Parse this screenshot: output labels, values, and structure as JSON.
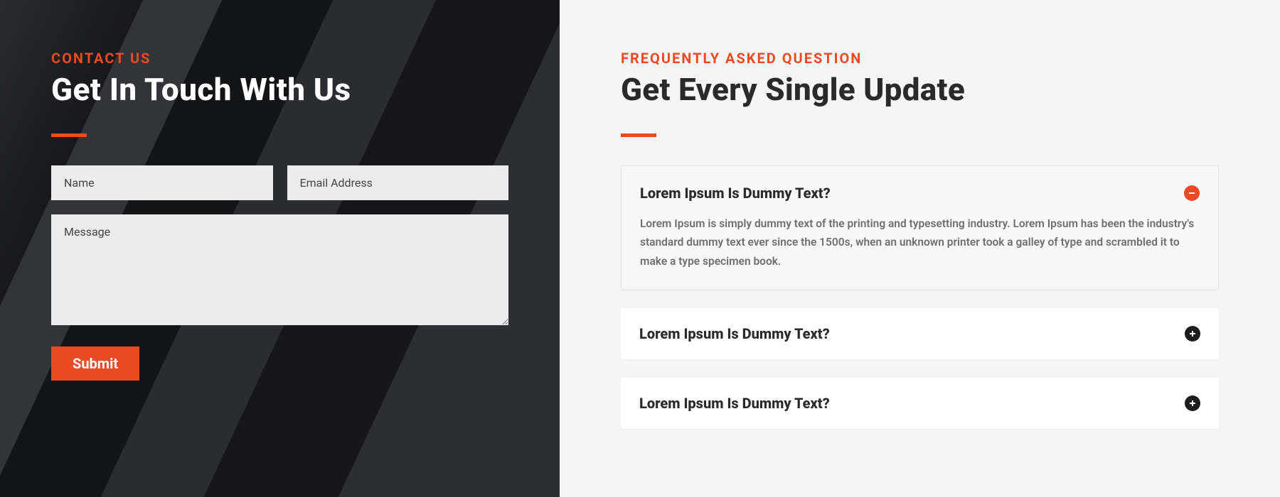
{
  "contact": {
    "eyebrow": "CONTACT US",
    "heading": "Get In Touch With Us",
    "name_placeholder": "Name",
    "email_placeholder": "Email Address",
    "message_placeholder": "Message",
    "submit_label": "Submit"
  },
  "faq": {
    "eyebrow": "FREQUENTLY ASKED QUESTION",
    "heading": "Get Every Single Update",
    "items": [
      {
        "question": "Lorem Ipsum Is Dummy Text?",
        "expanded": true,
        "answer": "Lorem Ipsum is simply dummy text of the printing and typesetting industry. Lorem Ipsum has been the industry's standard dummy text ever since the 1500s, when an unknown printer took a galley of type and scrambled it to make a type specimen book."
      },
      {
        "question": "Lorem Ipsum Is Dummy Text?",
        "expanded": false
      },
      {
        "question": "Lorem Ipsum Is Dummy Text?",
        "expanded": false
      }
    ]
  }
}
